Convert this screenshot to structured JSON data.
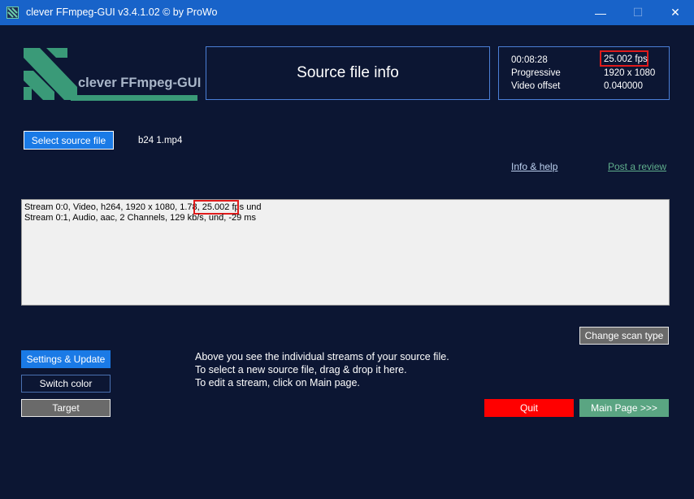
{
  "window": {
    "title": "clever FFmpeg-GUI v3.4.1.02   © by ProWo",
    "minimize_glyph": "—",
    "maximize_glyph": "☐",
    "close_glyph": "✕"
  },
  "logo": {
    "text": "clever FFmpeg-GUI"
  },
  "source_info": {
    "title": "Source file info",
    "duration": "00:08:28",
    "fps": "25.002 fps",
    "scan": "Progressive",
    "resolution": "1920 x 1080",
    "video_offset_label": "Video offset",
    "video_offset": "0.040000"
  },
  "select_source_label": "Select source file",
  "source_file": "b24 1.mp4",
  "links": {
    "info_help": "Info & help",
    "review": "Post a review"
  },
  "streams": {
    "stream0_prefix": "Stream 0:0, Video, h264, 1920 x 1080, 1.78,",
    "stream0_fps": "25.002 fps",
    "stream0_suffix": "und",
    "stream1": "Stream 0:1, Audio, aac, 2 Channels, 129 kb/s, und, -29 ms"
  },
  "buttons": {
    "change_scan": "Change scan type",
    "settings": "Settings & Update",
    "switch_color": "Switch color",
    "target": "Target",
    "quit": "Quit",
    "main_page": "Main Page >>>"
  },
  "hints": [
    "Above you see the individual streams of your source file.",
    "To select a new source file, drag & drop it here.",
    "To edit a stream, click on Main page."
  ],
  "colors": {
    "background": "#0c1633",
    "titlebar": "#1863c9",
    "accent_blue": "#1a7ae6",
    "quit_red": "#ff0000",
    "main_green": "#5aa582",
    "highlight_red": "#e01b1b"
  }
}
